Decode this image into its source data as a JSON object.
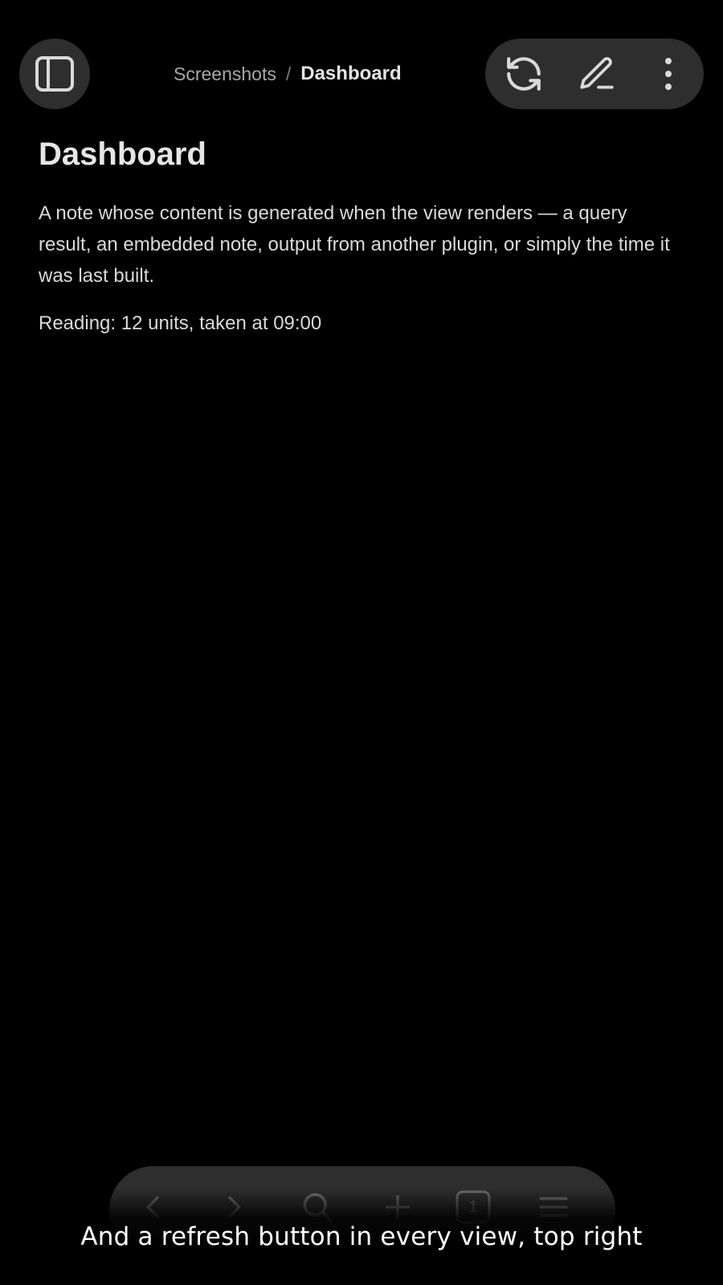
{
  "header": {
    "sidebar_icon": "sidebar-toggle-icon",
    "breadcrumb": {
      "parent": "Screenshots",
      "separator": "/",
      "current": "Dashboard"
    },
    "actions": {
      "refresh_icon": "refresh-icon",
      "edit_icon": "pencil-icon",
      "more_icon": "more-vertical-icon"
    }
  },
  "note": {
    "title": "Dashboard",
    "body": "A note whose content is generated when the view renders — a query result, an embedded note, output from another plugin, or simply the time it was last built.",
    "reading": "Reading: 12 units, taken at 09:00"
  },
  "bottom_nav": {
    "icons": [
      "back-icon",
      "forward-icon",
      "search-icon",
      "plus-icon",
      "tabs-icon",
      "menu-icon"
    ],
    "tab_count": "1"
  },
  "caption": "And a refresh button in every view, top right",
  "colors": {
    "background": "#000000",
    "surface": "#2e2e2e",
    "text": "#dadada",
    "muted_text": "#a8a8a8"
  }
}
